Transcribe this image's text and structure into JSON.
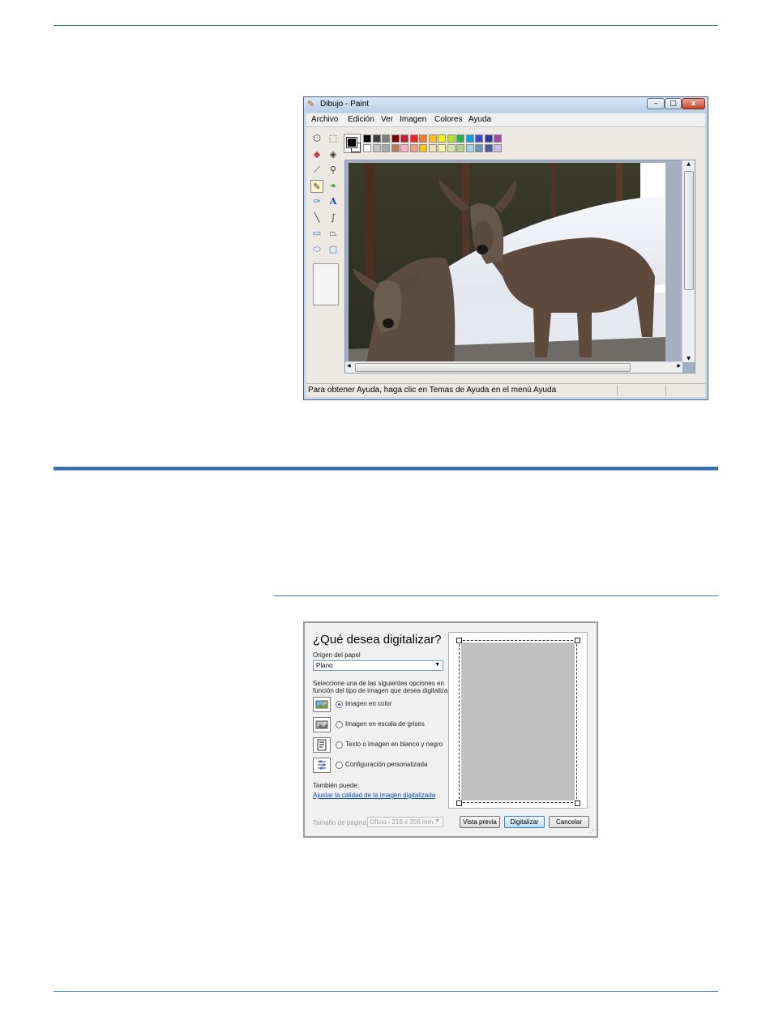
{
  "paint": {
    "title": "Dibujo - Paint",
    "window_controls": {
      "minimize": "–",
      "maximize": "□",
      "close": "x"
    },
    "menu": [
      "Archivo",
      "Edición",
      "Ver",
      "Imagen",
      "Colores",
      "Ayuda"
    ],
    "tools": [
      {
        "name": "free-select-icon",
        "glyph": "⬡"
      },
      {
        "name": "rect-select-icon",
        "glyph": "⬚"
      },
      {
        "name": "eraser-icon",
        "glyph": "◆"
      },
      {
        "name": "fill-bucket-icon",
        "glyph": "◈"
      },
      {
        "name": "color-picker-icon",
        "glyph": "⟋"
      },
      {
        "name": "magnifier-icon",
        "glyph": "⚲"
      },
      {
        "name": "pencil-icon",
        "glyph": "✎"
      },
      {
        "name": "brush-icon",
        "glyph": "❧"
      },
      {
        "name": "airbrush-icon",
        "glyph": "✑"
      },
      {
        "name": "text-icon",
        "glyph": "A"
      },
      {
        "name": "line-icon",
        "glyph": "╲"
      },
      {
        "name": "curve-icon",
        "glyph": "∫"
      },
      {
        "name": "rectangle-icon",
        "glyph": "▭"
      },
      {
        "name": "polygon-icon",
        "glyph": "⏢"
      },
      {
        "name": "ellipse-icon",
        "glyph": "⬭"
      },
      {
        "name": "rounded-rect-icon",
        "glyph": "▢"
      }
    ],
    "selected_tool": 6,
    "palette_top": [
      "#000000",
      "#404040",
      "#808080",
      "#800000",
      "#c81e3c",
      "#ff2020",
      "#ff7f27",
      "#ffc20e",
      "#fff200",
      "#b5e61d",
      "#22b14c",
      "#00a2e8",
      "#3f48cc",
      "#2f3699",
      "#a349a4"
    ],
    "palette_bottom": [
      "#ffffff",
      "#c3c3c3",
      "#a8a8a8",
      "#b97a57",
      "#ffaec9",
      "#f5a07a",
      "#ffc90e",
      "#efe4b0",
      "#fff5a0",
      "#d0e8a0",
      "#b5d08a",
      "#99d9ea",
      "#7092be",
      "#4a5a9a",
      "#c8bfe7"
    ],
    "foreground": "#000000",
    "background": "#ffffff",
    "status": "Para obtener Ayuda, haga clic en Temas de Ayuda en el menú Ayuda"
  },
  "scan_dialog": {
    "title": "¿Qué desea digitalizar?",
    "paper_source_label": "Origen del papel",
    "paper_source_value": "Plano",
    "instructions_line1": "Seleccione una de las siguientes opciones en",
    "instructions_line2": "función del tipo de imagen que desea digitalizar.",
    "options": [
      {
        "label": "Imagen en color",
        "selected": true
      },
      {
        "label": "Imagen en escala de grises",
        "selected": false
      },
      {
        "label": "Texto o imagen en blanco y negro",
        "selected": false
      },
      {
        "label": "Configuración personalizada",
        "selected": false
      }
    ],
    "also_label": "También puede:",
    "adjust_link": "Ajustar la calidad de la imagen digitalizada",
    "page_size_label": "Tamaño de página:",
    "page_size_value": "Oficio - 216 x 356 mm",
    "buttons": {
      "preview": "Vista previa",
      "scan": "Digitalizar",
      "cancel": "Cancelar"
    }
  }
}
